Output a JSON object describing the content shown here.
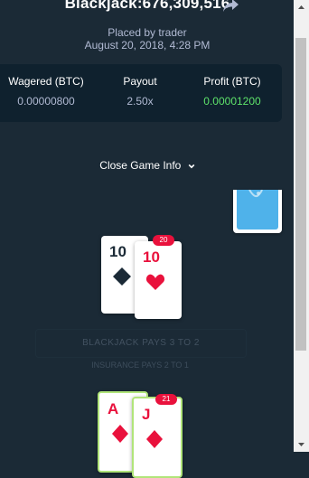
{
  "header": {
    "title": "Blackjack:676,309,516",
    "placed_by": "Placed by trader",
    "date": "August 20, 2018, 4:28 PM"
  },
  "stats": {
    "wagered_label": "Wagered (BTC)",
    "wagered_value": "0.00000800",
    "payout_label": "Payout",
    "payout_value": "2.50x",
    "profit_label": "Profit (BTC)",
    "profit_value": "0.00001200"
  },
  "toggle": {
    "label": "Close Game Info"
  },
  "dealer_hand": {
    "total": "20",
    "cards": [
      {
        "rank": "10",
        "suit": "spade-icon"
      },
      {
        "rank": "10",
        "suit": "heart-icon"
      }
    ]
  },
  "player_hand": {
    "total": "21",
    "cards": [
      {
        "rank": "A",
        "suit": "diamond-icon"
      },
      {
        "rank": "J",
        "suit": "diamond-icon"
      }
    ]
  },
  "faded_button": {
    "label": "BLACKJACK PAYS 3 TO 2"
  },
  "faded_note": {
    "label": "INSURANCE PAYS 2 TO 1"
  },
  "colors": {
    "background": "#1b2a36",
    "panel": "#0f212e",
    "profit": "#5ee26a",
    "red": "#e9113c",
    "win_border": "#b1e57a"
  }
}
